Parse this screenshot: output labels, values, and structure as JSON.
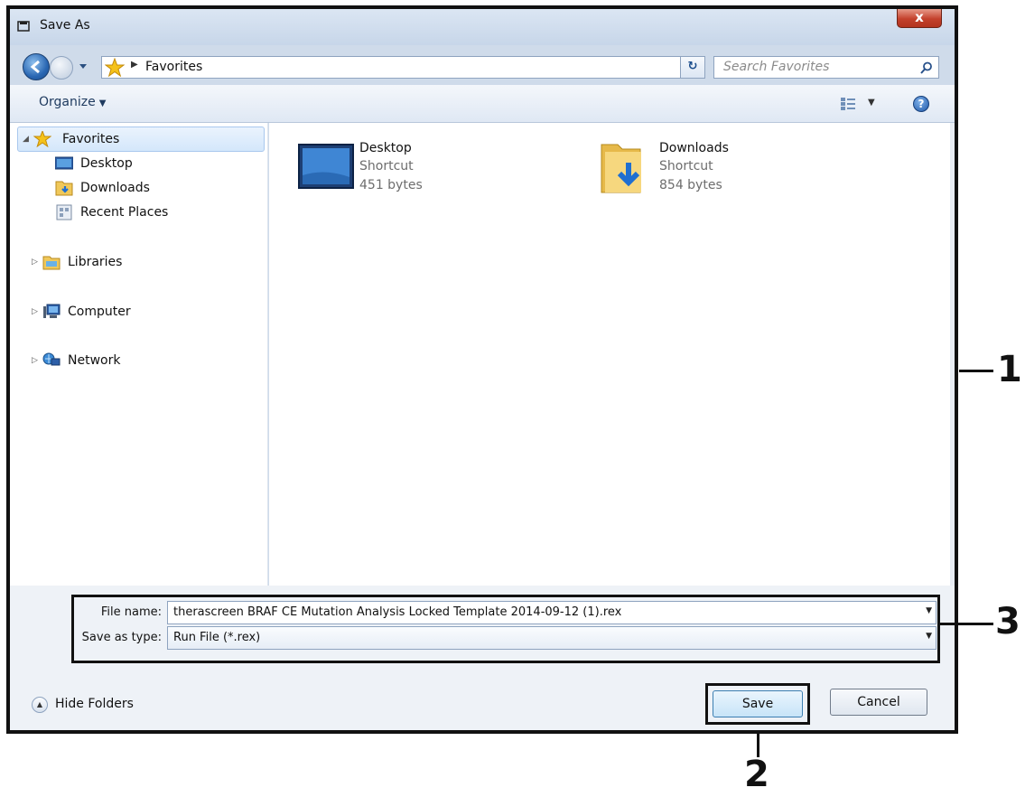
{
  "window": {
    "title": "Save As",
    "close_label": "x"
  },
  "address_bar": {
    "breadcrumb": "Favorites",
    "search_placeholder": "Search Favorites"
  },
  "toolbar": {
    "organize_label": "Organize",
    "help_label": "?"
  },
  "nav_pane": {
    "favorites": "Favorites",
    "favorites_items": [
      "Desktop",
      "Downloads",
      "Recent Places"
    ],
    "libraries": "Libraries",
    "computer": "Computer",
    "network": "Network"
  },
  "files": [
    {
      "name": "Desktop",
      "type": "Shortcut",
      "size": "451 bytes",
      "icon": "desktop-icon"
    },
    {
      "name": "Downloads",
      "type": "Shortcut",
      "size": "854 bytes",
      "icon": "downloads-folder-icon"
    }
  ],
  "form": {
    "file_name_label": "File name:",
    "file_name_value": "therascreen BRAF CE Mutation Analysis Locked Template 2014-09-12 (1).rex",
    "save_as_type_label": "Save as type:",
    "save_as_type_value": "Run File (*.rex)"
  },
  "buttons": {
    "hide_folders": "Hide Folders",
    "save": "Save",
    "cancel": "Cancel"
  },
  "callouts": [
    "1",
    "2",
    "3"
  ],
  "colors": {
    "frame": "#cfdbea",
    "selection": "#d4e7fb",
    "close_red": "#c3412c"
  }
}
